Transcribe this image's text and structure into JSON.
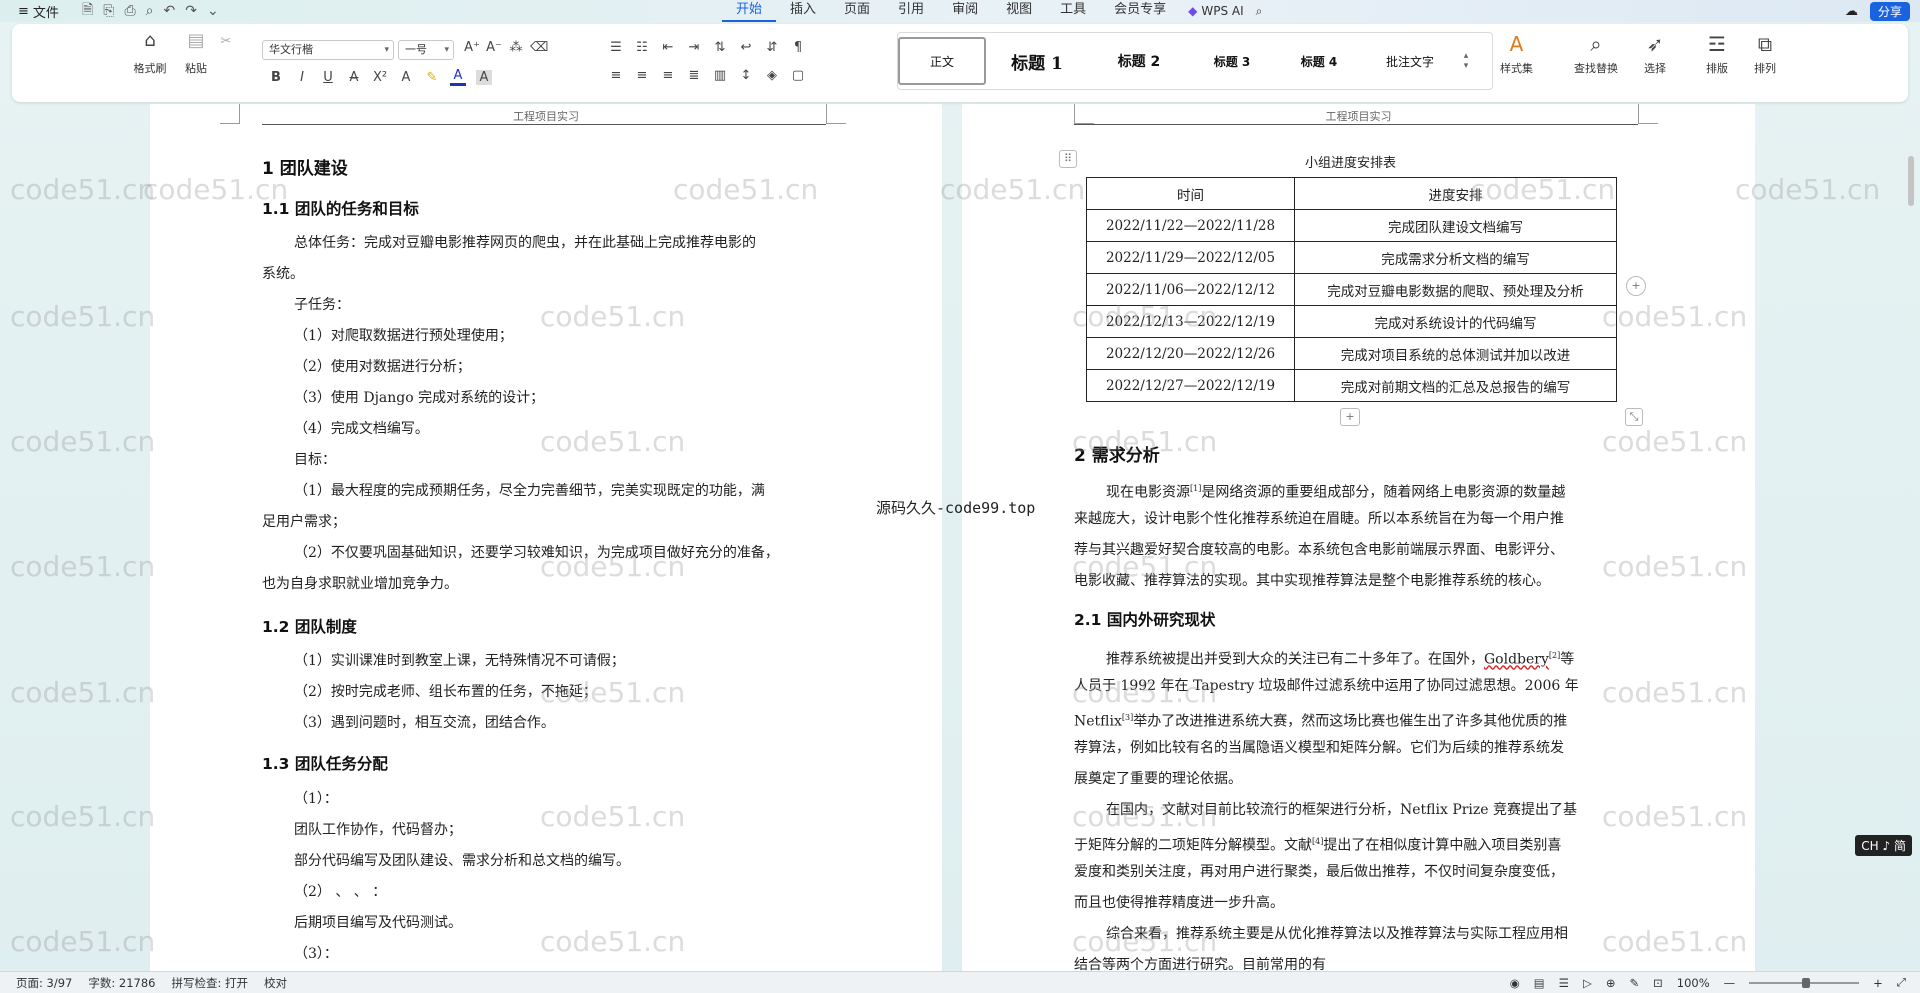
{
  "menubar": {
    "file_label": "文件",
    "tabs": [
      {
        "label": "开始",
        "active": true
      },
      {
        "label": "插入"
      },
      {
        "label": "页面"
      },
      {
        "label": "引用"
      },
      {
        "label": "审阅"
      },
      {
        "label": "视图"
      },
      {
        "label": "工具"
      },
      {
        "label": "会员专享"
      }
    ],
    "ai_label": "WPS AI",
    "share_label": "分享"
  },
  "ribbon": {
    "format_painter": "格式刷",
    "paste": "粘贴",
    "font_name": "华文行楷",
    "font_size": "一号",
    "styles": [
      "正文",
      "标题 1",
      "标题 2",
      "标题 3",
      "标题 4",
      "批注文字"
    ],
    "style_set": "样式集",
    "find_replace": "查找替换",
    "select": "选择",
    "layout": "排版",
    "arrange": "排列"
  },
  "page_header": "工程项目实习",
  "left_page": {
    "h1": "1  团队建设",
    "h1_1": "1.1  团队的任务和目标",
    "p1a": "总体任务：完成对豆瓣电影推荐网页的爬虫，并在此基础上完成推荐电影的",
    "p1b": "系统。",
    "sub_tasks_label": "子任务：",
    "sub_tasks": [
      "（1）对爬取数据进行预处理使用；",
      "（2）使用对数据进行分析；",
      "（3）使用 Django 完成对系统的设计；",
      "（4）完成文档编写。"
    ],
    "goal_label": "目标：",
    "goal1a": "（1）最大程度的完成预期任务，尽全力完善细节，完美实现既定的功能，满",
    "goal1b": "足用户需求；",
    "goal2a": "（2）不仅要巩固基础知识，还要学习较难知识，为完成项目做好充分的准备，",
    "goal2b": "也为自身求职就业增加竞争力。",
    "h1_2": "1.2  团队制度",
    "rules": [
      "（1）实训课准时到教室上课，无特殊情况不可请假；",
      "（2）按时完成老师、组长布置的任务，不拖延；",
      "（3）遇到问题时，相互交流，团结合作。"
    ],
    "h1_3": "1.3  团队任务分配",
    "assign1": "（1）：",
    "assign1_a": "团队工作协作，代码督办；",
    "assign1_b": "部分代码编写及团队建设、需求分析和总文档的编写。",
    "assign2": "（2）  、  、  ：",
    "assign2_a": "后期项目编写及代码测试。",
    "assign3": "（3）："
  },
  "right_page": {
    "table_caption": "小组进度安排表",
    "table_header": [
      "时间",
      "进度安排"
    ],
    "table_rows": [
      [
        "2022/11/22—2022/11/28",
        "完成团队建设文档编写"
      ],
      [
        "2022/11/29—2022/12/05",
        "完成需求分析文档的编写"
      ],
      [
        "2022/11/06—2022/12/12",
        "完成对豆瓣电影数据的爬取、预处理及分析"
      ],
      [
        "2022/12/13—2022/12/19",
        "完成对系统设计的代码编写"
      ],
      [
        "2022/12/20—2022/12/26",
        "完成对项目系统的总体测试并加以改进"
      ],
      [
        "2022/12/27—2022/12/19",
        "完成对前期文档的汇总及总报告的编写"
      ]
    ],
    "h2": "2  需求分析",
    "p2_1": "现在电影资源",
    "p2_ref1": "[1]",
    "p2_1b": "是网络资源的重要组成部分，随着网络上电影资源的数量越",
    "p2_2": "来越庞大，设计电影个性化推荐系统迫在眉睫。所以本系统旨在为每一个用户推",
    "p2_3": "荐与其兴趣爱好契合度较高的电影。本系统包含电影前端展示界面、电影评分、",
    "p2_4": "电影收藏、推荐算法的实现。其中实现推荐算法是整个电影推荐系统的核心。",
    "h2_1": "2.1  国内外研究现状",
    "p3_1a": "推荐系统被提出并受到大众的关注已有二十多年了。在国外，",
    "p3_goldberg": "Goldbery",
    "p3_ref2": "[2]",
    "p3_1b": "等",
    "p3_2": "人员于  1992  年在  Tapestry  垃圾邮件过滤系统中运用了协同过滤思想。2006  年",
    "p3_3a": "Netflix",
    "p3_ref3": "[3]",
    "p3_3b": "举办了改进推进系统大赛，然而这场比赛也催生出了许多其他优质的推",
    "p3_4": "荐算法，例如比较有名的当属隐语义模型和矩阵分解。它们为后续的推荐系统发",
    "p3_5": "展奠定了重要的理论依据。",
    "p4_1": "在国内，文献对目前比较流行的框架进行分析，Netflix Prize  竞赛提出了基",
    "p4_2a": "于矩阵分解的二项矩阵分解模型。文献",
    "p4_ref4": "[4]",
    "p4_2b": "提出了在相似度计算中融入项目类别喜",
    "p4_3": "爱度和类别关注度，再对用户进行聚类，最后做出推荐，不仅时间复杂度变低，",
    "p4_4": "而且也使得推荐精度进一步升高。",
    "p5_1": "综合来看，推荐系统主要是从优化推荐算法以及推荐算法与实际工程应用相",
    "p5_2": "结合等两个方面进行研究。目前常用的有"
  },
  "overlay": {
    "watermark": "code51.cn",
    "mid_label": "源码久久-code99.top",
    "ime_badge": "CH ♪ 简"
  },
  "statusbar": {
    "page": "页面: 3/97",
    "words": "字数: 21786",
    "spell": "拼写检查: 打开",
    "proof": "校对",
    "zoom": "100%"
  }
}
